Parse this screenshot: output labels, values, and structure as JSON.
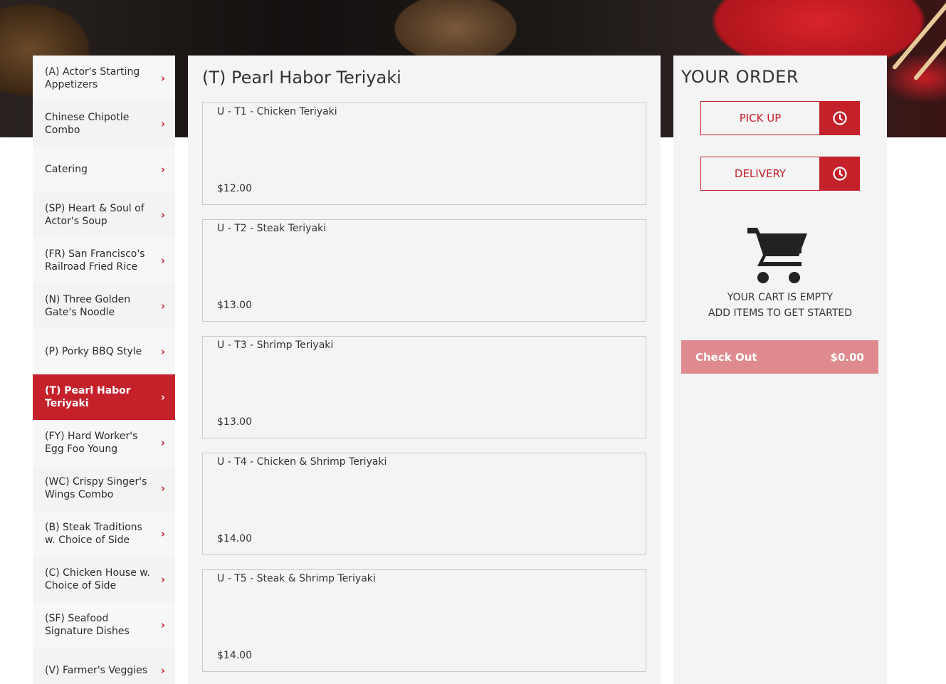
{
  "categories": [
    {
      "label": "(A) Actor's Starting Appetizers"
    },
    {
      "label": "Chinese Chipotle Combo"
    },
    {
      "label": "Catering"
    },
    {
      "label": "(SP) Heart & Soul of Actor's Soup"
    },
    {
      "label": "(FR) San Francisco's Railroad Fried Rice"
    },
    {
      "label": "(N) Three Golden Gate's Noodle"
    },
    {
      "label": "(P) Porky BBQ Style"
    },
    {
      "label": "(T) Pearl Habor Teriyaki"
    },
    {
      "label": "(FY) Hard Worker's Egg Foo Young"
    },
    {
      "label": "(WC) Crispy Singer's Wings Combo"
    },
    {
      "label": "(B) Steak Traditions w. Choice of Side"
    },
    {
      "label": "(C) Chicken House w. Choice of Side"
    },
    {
      "label": "(SF) Seafood Signature Dishes"
    },
    {
      "label": "(V) Farmer's Veggies"
    }
  ],
  "active_category_index": 7,
  "chevron": "›",
  "menu": {
    "title": "(T) Pearl Habor Teriyaki",
    "items": [
      {
        "name": "U - T1 - Chicken Teriyaki",
        "price": "$12.00"
      },
      {
        "name": "U - T2 - Steak Teriyaki",
        "price": "$13.00"
      },
      {
        "name": "U - T3 - Shrimp Teriyaki",
        "price": "$13.00"
      },
      {
        "name": "U - T4 - Chicken & Shrimp Teriyaki",
        "price": "$14.00"
      },
      {
        "name": "U - T5 - Steak & Shrimp Teriyaki",
        "price": "$14.00"
      }
    ]
  },
  "order": {
    "title": "YOUR ORDER",
    "pickup_label": "PICK UP",
    "delivery_label": "DELIVERY",
    "empty_line1": "YOUR CART IS EMPTY",
    "empty_line2": "ADD ITEMS TO GET STARTED",
    "checkout_label": "Check Out",
    "checkout_total": "$0.00"
  },
  "colors": {
    "accent": "#c4212b",
    "checkout_disabled": "#de8a8e",
    "panel_bg": "#f4f4f4"
  },
  "icons": {
    "mode": "clock-icon",
    "cart": "shopping-cart-icon",
    "nav": "chevron-right-icon"
  }
}
